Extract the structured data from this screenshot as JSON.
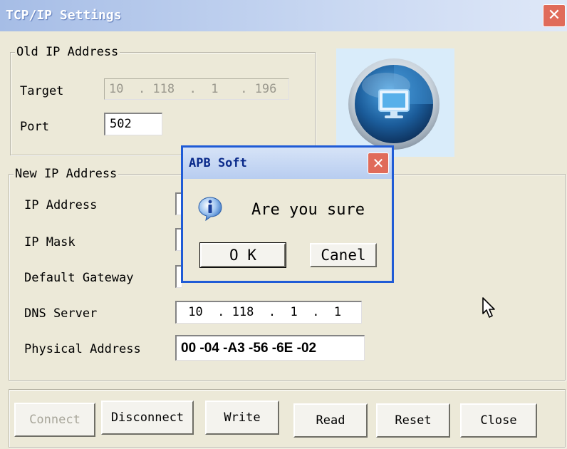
{
  "window": {
    "title": "TCP/IP Settings",
    "close_icon": "close-icon"
  },
  "old_ip": {
    "legend": "Old IP Address",
    "target_label": "Target",
    "target_value": "10  . 118  .  1   . 196",
    "port_label": "Port",
    "port_value": "502"
  },
  "new_ip": {
    "legend": "New IP Address",
    "ip_label": "IP Address",
    "mask_label": "IP Mask",
    "gateway_label": "Default Gateway",
    "dns_label": "DNS Server",
    "dns_value": " 10  . 118  .  1  .  1",
    "mac_label": "Physical Address",
    "mac_value": "00 -04 -A3 -56 -6E -02"
  },
  "buttons": {
    "connect": "Connect",
    "disconnect": "Disconnect",
    "write": "Write",
    "read": "Read",
    "reset": "Reset",
    "close": "Close"
  },
  "dialog": {
    "title": "APB Soft",
    "message": "Are you sure",
    "ok": "O K",
    "cancel": "Canel"
  },
  "icons": [
    "close-icon",
    "monitor-globe-logo-icon",
    "info-icon",
    "mouse-pointer-icon"
  ]
}
